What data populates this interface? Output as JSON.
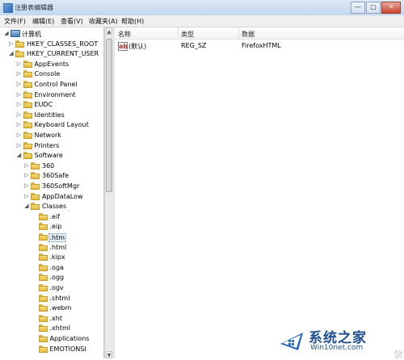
{
  "window": {
    "title": "注册表编辑器",
    "buttons": {
      "minimize": "—",
      "maximize": "▢",
      "close": "✕"
    }
  },
  "menu": [
    "文件(F)",
    "编辑(E)",
    "查看(V)",
    "收藏夹(A)",
    "帮助(H)"
  ],
  "tree": {
    "root": "计算机",
    "nodes": [
      {
        "label": "HKEY_CLASSES_ROOT",
        "level": 1,
        "expanded": false
      },
      {
        "label": "HKEY_CURRENT_USER",
        "level": 1,
        "expanded": true
      },
      {
        "label": "AppEvents",
        "level": 2,
        "expanded": false
      },
      {
        "label": "Console",
        "level": 2,
        "expanded": false
      },
      {
        "label": "Control Panel",
        "level": 2,
        "expanded": false
      },
      {
        "label": "Environment",
        "level": 2,
        "expanded": false
      },
      {
        "label": "EUDC",
        "level": 2,
        "expanded": false
      },
      {
        "label": "Identities",
        "level": 2,
        "expanded": false
      },
      {
        "label": "Keyboard Layout",
        "level": 2,
        "expanded": false
      },
      {
        "label": "Network",
        "level": 2,
        "expanded": false
      },
      {
        "label": "Printers",
        "level": 2,
        "expanded": false
      },
      {
        "label": "Software",
        "level": 2,
        "expanded": true
      },
      {
        "label": "360",
        "level": 3,
        "expanded": false
      },
      {
        "label": "360Safe",
        "level": 3,
        "expanded": false
      },
      {
        "label": "360SoftMgr",
        "level": 3,
        "expanded": false
      },
      {
        "label": "AppDataLow",
        "level": 3,
        "expanded": false
      },
      {
        "label": "Classes",
        "level": 3,
        "expanded": true
      },
      {
        "label": ".eif",
        "level": 4,
        "expanded": false
      },
      {
        "label": ".eip",
        "level": 4,
        "expanded": false
      },
      {
        "label": ".htm",
        "level": 4,
        "expanded": false,
        "selected": true
      },
      {
        "label": ".html",
        "level": 4,
        "expanded": false
      },
      {
        "label": ".kipx",
        "level": 4,
        "expanded": false
      },
      {
        "label": ".oga",
        "level": 4,
        "expanded": false
      },
      {
        "label": ".ogg",
        "level": 4,
        "expanded": false
      },
      {
        "label": ".ogv",
        "level": 4,
        "expanded": false
      },
      {
        "label": ".shtml",
        "level": 4,
        "expanded": false
      },
      {
        "label": ".webm",
        "level": 4,
        "expanded": false
      },
      {
        "label": ".xht",
        "level": 4,
        "expanded": false
      },
      {
        "label": ".xhtml",
        "level": 4,
        "expanded": false
      },
      {
        "label": "Applications",
        "level": 4,
        "expanded": false
      },
      {
        "label": "EMOTIONSI",
        "level": 4,
        "expanded": false
      }
    ]
  },
  "list": {
    "columns": [
      "名称",
      "类型",
      "数据"
    ],
    "rows": [
      {
        "name": "(默认)",
        "type": "REG_SZ",
        "data": "FirefoxHTML"
      }
    ]
  },
  "watermark": {
    "title": "系统之家",
    "url": "Win10net.com"
  },
  "colors": {
    "folder": "#f0c955",
    "accent": "#1e4f8f",
    "selection": "#e6eefb"
  },
  "icons": [
    "computer-icon",
    "folder-icon",
    "string-value-icon",
    "expand-arrow-icon",
    "collapse-arrow-icon"
  ]
}
